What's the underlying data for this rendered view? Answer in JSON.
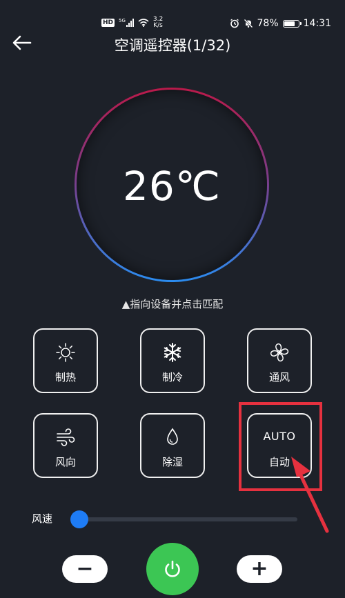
{
  "status_bar": {
    "hd": "HD",
    "network_type": "5G",
    "net_speed_value": "3.2",
    "net_speed_unit": "K/s",
    "battery": "78%",
    "battery_level": 0.78,
    "time": "14:31"
  },
  "header": {
    "title": "空调遥控器(1/32)",
    "back_icon": "arrow-left-icon"
  },
  "dial": {
    "temperature": "26℃",
    "gradient_colors": [
      "#ba1a4a",
      "#2b8cf0"
    ]
  },
  "hint": "▲指向设备并点击匹配",
  "modes": [
    {
      "label": "制热",
      "icon": "sun-icon"
    },
    {
      "label": "制冷",
      "icon": "snowflake-icon"
    },
    {
      "label": "通风",
      "icon": "fan-icon"
    },
    {
      "label": "风向",
      "icon": "wind-icon"
    },
    {
      "label": "除湿",
      "icon": "water-drop-icon"
    },
    {
      "label": "自动",
      "icon_text": "AUTO"
    }
  ],
  "fan_speed": {
    "label": "风速",
    "value": 0
  },
  "controls": {
    "minus_symbol": "−",
    "plus_symbol": "+",
    "power_icon": "power-icon"
  },
  "colors": {
    "background": "#1d2129",
    "accent_blue": "#1e7cf5",
    "power_green": "#3cc654",
    "annotation_red": "#e6313f"
  }
}
